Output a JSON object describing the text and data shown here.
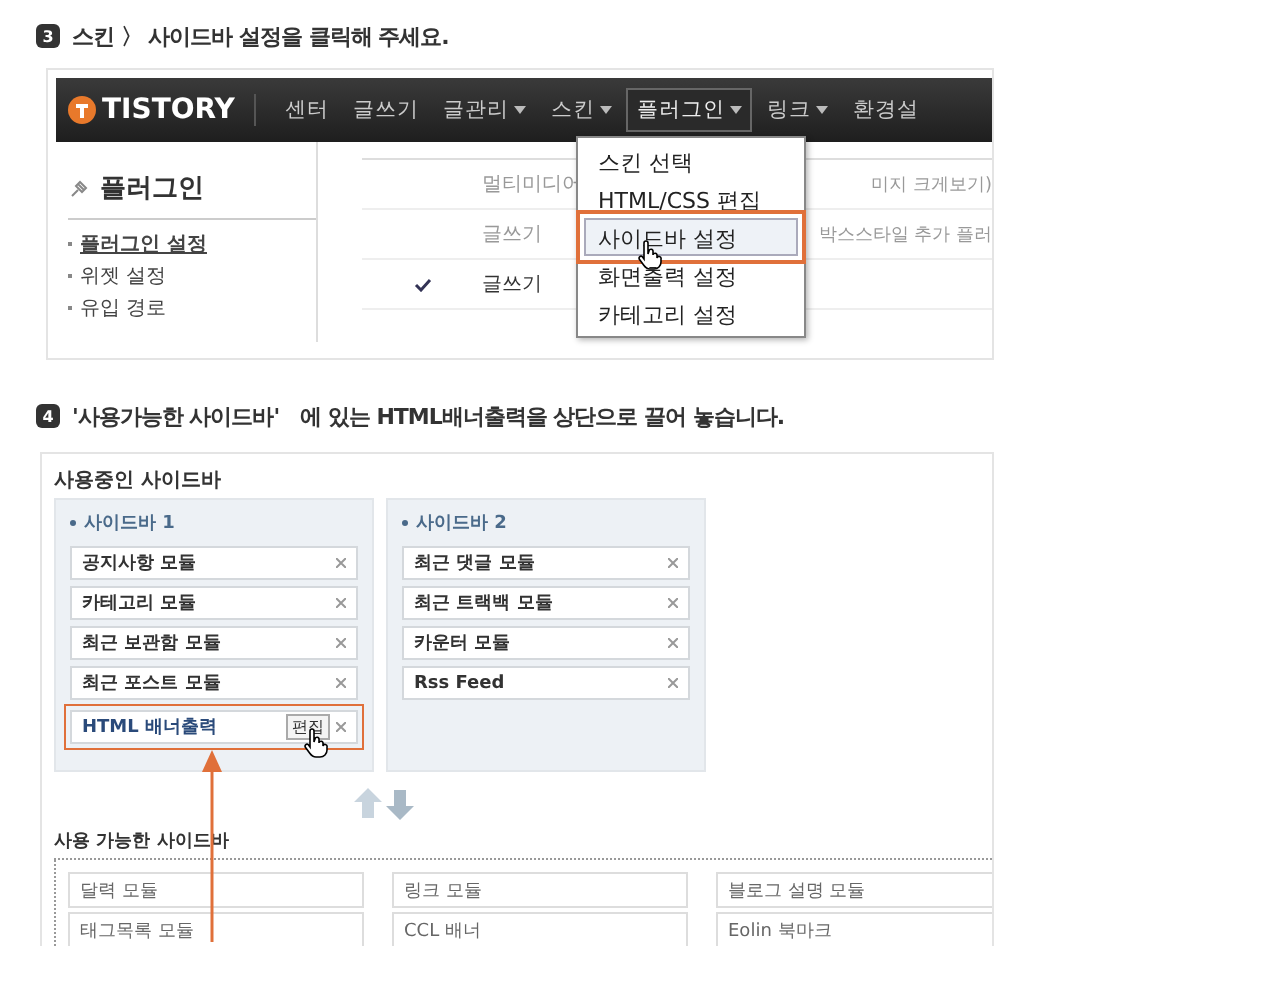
{
  "step3": {
    "number": "3",
    "text": "스킨 〉 사이드바 설정을 클릭해 주세요."
  },
  "admin": {
    "logo": "TISTORY",
    "nav": [
      {
        "label": "센터",
        "dropdown": false,
        "selected": false
      },
      {
        "label": "글쓰기",
        "dropdown": false,
        "selected": false
      },
      {
        "label": "글관리",
        "dropdown": true,
        "selected": false
      },
      {
        "label": "스킨",
        "dropdown": true,
        "selected": false
      },
      {
        "label": "플러그인",
        "dropdown": true,
        "selected": true
      },
      {
        "label": "링크",
        "dropdown": true,
        "selected": false
      },
      {
        "label": "환경설",
        "dropdown": false,
        "selected": false
      }
    ],
    "sidebar": {
      "title": "플러그인",
      "items": [
        {
          "label": "플러그인 설정",
          "selected": true
        },
        {
          "label": "위젯 설정",
          "selected": false
        },
        {
          "label": "유입 경로",
          "selected": false
        }
      ]
    },
    "rows": [
      {
        "checked": false,
        "category": "멀티미디어",
        "description": "미지 크게보기)"
      },
      {
        "checked": false,
        "category": "글쓰기",
        "description": "박스스타일 추가 플러"
      },
      {
        "checked": true,
        "category": "글쓰기",
        "description": ""
      }
    ],
    "menu": [
      {
        "label": "스킨 선택",
        "selected": false
      },
      {
        "label": "HTML/CSS 편집",
        "selected": false
      },
      {
        "label": "사이드바 설정",
        "selected": true
      },
      {
        "label": "화면출력 설정",
        "selected": false
      },
      {
        "label": "카테고리 설정",
        "selected": false
      }
    ]
  },
  "step4": {
    "number": "4",
    "text": "'사용가능한 사이드바'　에 있는 HTML배너출력을 상단으로 끌어 놓습니다."
  },
  "sidebars": {
    "title": "사용중인 사이드바",
    "columns": [
      {
        "title": "사이드바 1",
        "modules": [
          {
            "label": "공지사항 모듈",
            "highlighted": false
          },
          {
            "label": "카테고리 모듈",
            "highlighted": false
          },
          {
            "label": "최근 보관함 모듈",
            "highlighted": false
          },
          {
            "label": "최근 포스트 모듈",
            "highlighted": false
          },
          {
            "label": "HTML 배너출력",
            "highlighted": true,
            "edit": "편집"
          }
        ]
      },
      {
        "title": "사이드바 2",
        "modules": [
          {
            "label": "최근 댓글 모듈",
            "highlighted": false
          },
          {
            "label": "최근 트랙백 모듈",
            "highlighted": false
          },
          {
            "label": "카운터 모듈",
            "highlighted": false
          },
          {
            "label": "Rss Feed",
            "highlighted": false
          }
        ]
      }
    ],
    "available_title": "사용 가능한 사이드바",
    "available": [
      {
        "label": "달력 모듈"
      },
      {
        "label": "링크 모듈"
      },
      {
        "label": "블로그 설명 모듈"
      },
      {
        "label": "태그목록 모듈"
      },
      {
        "label": "CCL 배너"
      },
      {
        "label": "Eolin 북마크"
      }
    ]
  }
}
